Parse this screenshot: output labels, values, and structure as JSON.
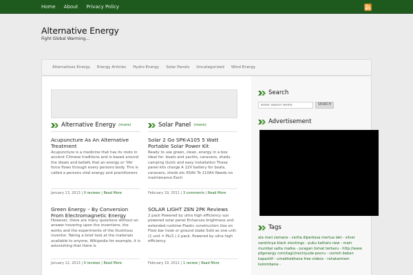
{
  "topnav": {
    "items": [
      "Home",
      "About",
      "Privacy Policy"
    ]
  },
  "rss": {
    "icon": "rss-icon"
  },
  "site": {
    "title": "Alternative Energy",
    "description": "Fight Global Warming..."
  },
  "catnav": {
    "items": [
      "Alternatives Energy",
      "Energy Articles",
      "Hydro Energy",
      "Solar Panels",
      "Uncategorized",
      "Wind Energy"
    ]
  },
  "sections": {
    "left": {
      "title": "Alternative Energy",
      "more": "(more)"
    },
    "right": {
      "title": "Solar Panel",
      "more": "(more)"
    }
  },
  "posts": [
    {
      "title": "Acupuncture As An Alternative Treatment",
      "body": "Acupuncture is a medicine that has its roots in ancient Chinese traditions and is based around the ideals and beliefs that an energy or 'life' force flows through every persons body. This is called a persons vital energy and practitioners",
      "date": "January 13, 2013 |",
      "comments": "0 reviews",
      "sep": "|",
      "readmore": "Read More"
    },
    {
      "title": "Solar 2 Go SPK-A105 5 Watt Portable Solar Power Kit",
      "body": "Ready to use green, clean, energy in a box Ideal for: boats and yachts, caravans, sheds, camping Quick and easy installation These panel kits charge A 12V battery for boats, caravans, sheds etc 65Ah To 110Ah Needs no maintenance Each",
      "date": "February 19, 2011 |",
      "comments": "3 comments",
      "sep": "|",
      "readmore": "Read More"
    },
    {
      "title": "Green Energy – By Conversion From Electromagnetic Energy",
      "body": "However, there are many questions without an answer hovering upon the inventions, the works and the experiments of the illustrious inventor. Taking a brief look at the materials available to anyone, Wikipedia for example, it is astonishing that there is",
      "date": "January 12, 2013 |",
      "comments": "0 reviews",
      "sep": "|",
      "readmore": "Read More"
    },
    {
      "title": "SOLAR LIGHT ZEN 2PK Reviews",
      "body": "2 pack Powered by ultra high efficiency sun powered solar panel Enhances brightness and extended runtime Plastic construction Use on Flexi-bar hook or ground stake Sold as one unit. (1 unit = Pk/2.) 2 pack. Powered by ultra high efficiency",
      "date": "February 19, 2011 |",
      "comments": "1 review",
      "sep": "|",
      "readmore": "Read More"
    }
  ],
  "sidebar": {
    "search": {
      "title": "Search",
      "placeholder": "enter search terms",
      "button": "SEARCH"
    },
    "ad": {
      "title": "Advertisement"
    },
    "tags": {
      "title": "Tags",
      "text": "ala mari zamane - cerita diperkosa mertua laki - silver sandrinya black stockings - puku kathalu new - main mumbai satta matka - juragan tomat terbaru - http://www pfgenergy com/tag/chechiyude-pooru - contoh beban kapasitif - umabhebhana free videos - rahatamtam kutombana -"
    }
  },
  "colors": {
    "topbar": "#1e5a1e",
    "link_green": "#1d6b1d",
    "accent_green": "#3a8a2a"
  }
}
